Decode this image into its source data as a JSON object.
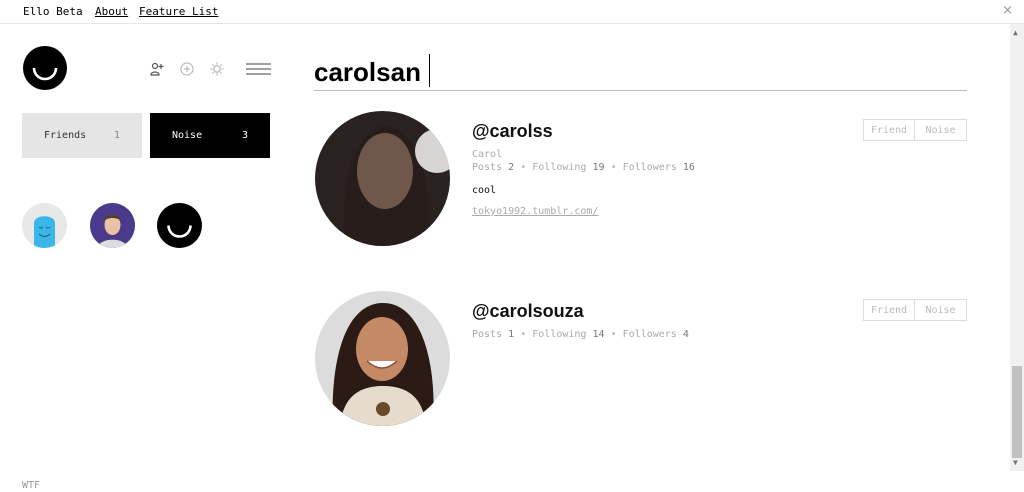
{
  "topbar": {
    "brand": "Ello Beta",
    "about": "About",
    "feature_list": "Feature List",
    "close_icon": "×"
  },
  "logo": {
    "icon": "ello-smile-logo"
  },
  "tools": {
    "invite_icon": "add-person-icon",
    "add_icon": "plus-circle-icon",
    "settings_icon": "gear-icon",
    "menu_icon": "hamburger-menu-icon"
  },
  "filters": {
    "friends": {
      "label": "Friends",
      "count": "1"
    },
    "noise": {
      "label": "Noise",
      "count": "3"
    }
  },
  "footer": {
    "wtf": "WTF"
  },
  "search": {
    "value": "carolsan"
  },
  "results": [
    {
      "username": "@carolss",
      "name": "Carol",
      "stats": {
        "posts_label": "Posts",
        "posts": "2",
        "following_label": "Following",
        "following": "19",
        "followers_label": "Followers",
        "followers": "16"
      },
      "bio": "cool",
      "link": "tokyo1992.tumblr.com/",
      "friend_label": "Friend",
      "noise_label": "Noise"
    },
    {
      "username": "@carolsouza",
      "stats": {
        "posts_label": "Posts",
        "posts": "1",
        "following_label": "Following",
        "following": "14",
        "followers_label": "Followers",
        "followers": "4"
      },
      "friend_label": "Friend",
      "noise_label": "Noise"
    }
  ],
  "colors": {
    "accent": "#000000",
    "muted": "#aaaaaa",
    "friends_bg": "#e5e5e5",
    "avatar_blue": "#3bb6e8"
  }
}
